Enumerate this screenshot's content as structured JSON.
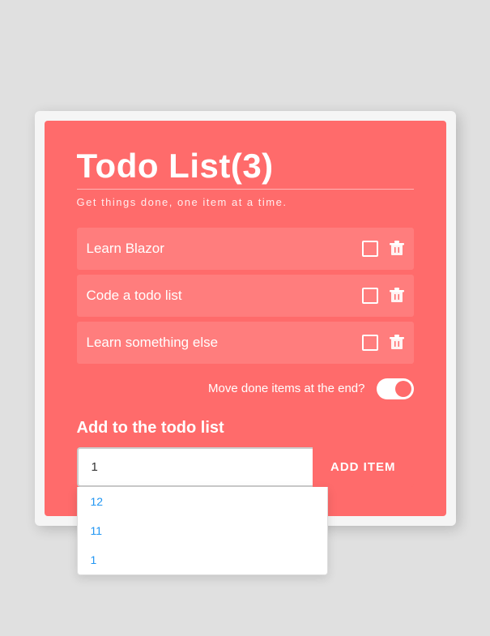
{
  "app": {
    "title": "Todo List(3)",
    "subtitle": "Get things done, one item at a time."
  },
  "todos": [
    {
      "id": 1,
      "text": "Learn Blazor",
      "done": false
    },
    {
      "id": 2,
      "text": "Code a todo list",
      "done": false
    },
    {
      "id": 3,
      "text": "Learn something else",
      "done": false
    }
  ],
  "moveDone": {
    "label": "Move done items at the end?",
    "enabled": true
  },
  "addSection": {
    "label": "Add to the todo list",
    "inputValue": "1",
    "inputPlaceholder": "",
    "buttonLabel": "ADD ITEM"
  },
  "autocomplete": {
    "items": [
      "12",
      "11",
      "1"
    ]
  },
  "icons": {
    "trash": "🗑",
    "checkbox": "☐"
  }
}
